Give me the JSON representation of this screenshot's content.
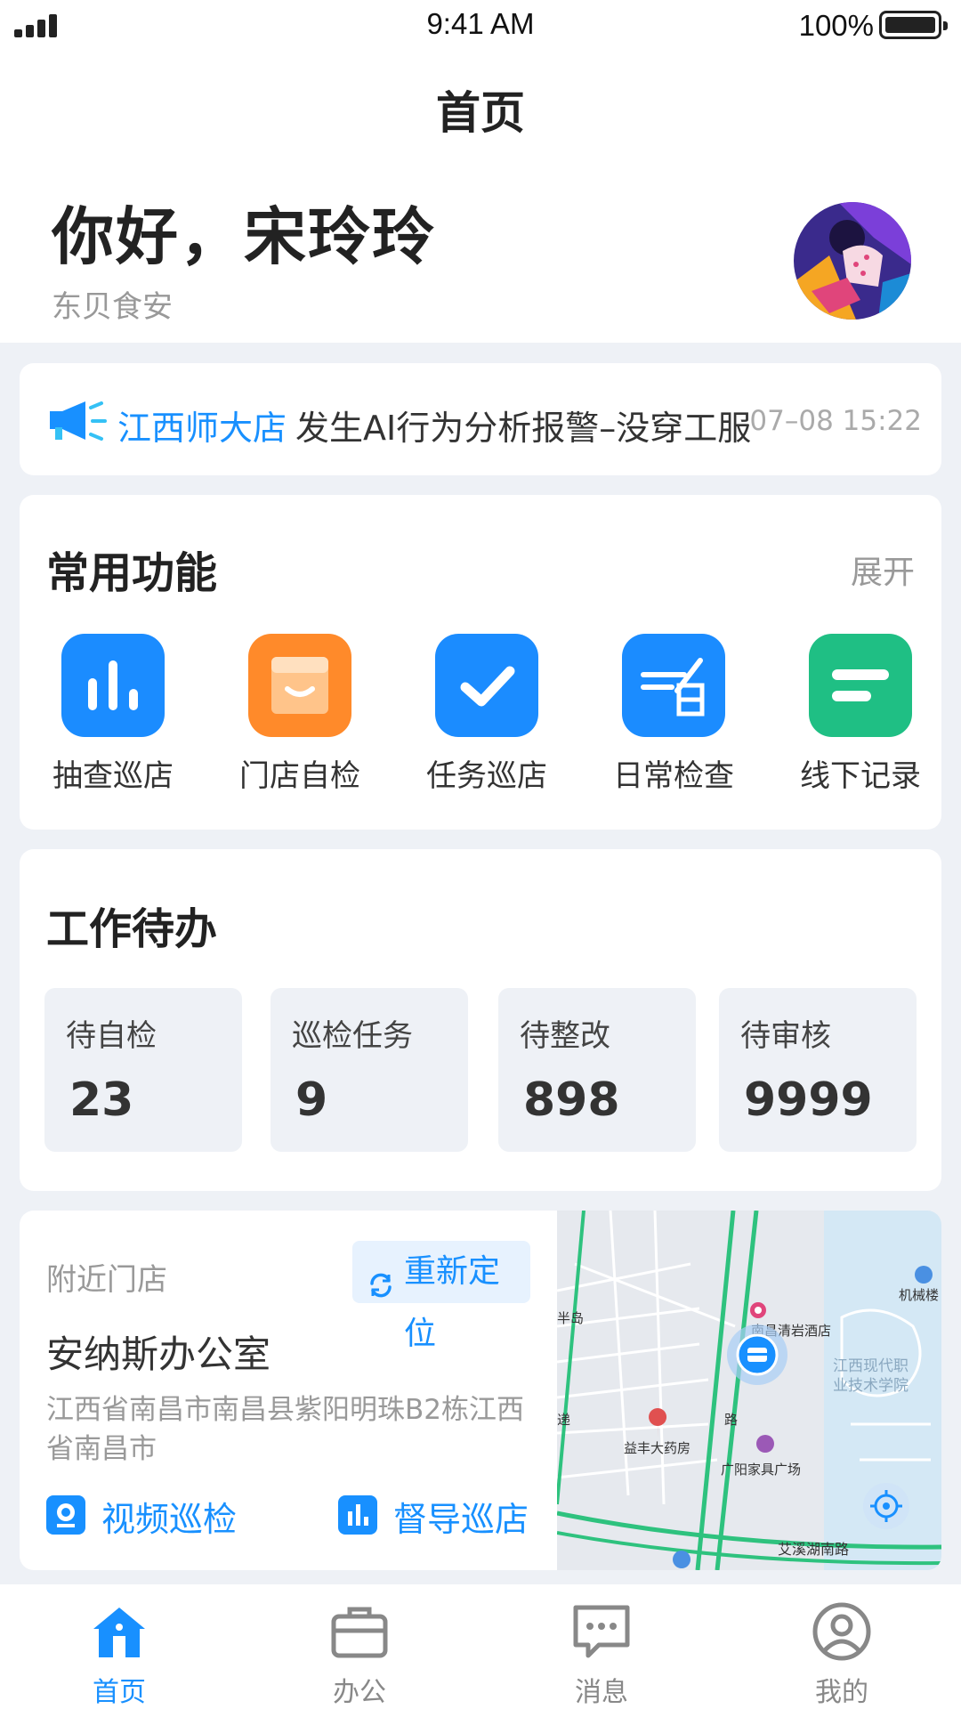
{
  "status_bar": {
    "time": "9:41 AM",
    "battery": "100%"
  },
  "header": {
    "title": "首页",
    "greeting": "你好，宋玲玲",
    "company": "东贝食安"
  },
  "notice": {
    "store": "江西师大店",
    "message": "发生AI行为分析报警–没穿工服",
    "time": "07–08 15:22"
  },
  "features": {
    "title": "常用功能",
    "expand_label": "展开",
    "items": [
      {
        "label": "抽查巡店",
        "icon": "bar-chart-icon",
        "color": "#1b8cff"
      },
      {
        "label": "门店自检",
        "icon": "storefront-icon",
        "color": "#ff8a2a"
      },
      {
        "label": "任务巡店",
        "icon": "checkmark-icon",
        "color": "#1b8cff"
      },
      {
        "label": "日常检查",
        "icon": "daily-calendar-icon",
        "color": "#1b8cff"
      },
      {
        "label": "线下记录",
        "icon": "record-lines-icon",
        "color": "#1fbf84"
      }
    ]
  },
  "todo": {
    "title": "工作待办",
    "items": [
      {
        "label": "待自检",
        "value": "23"
      },
      {
        "label": "巡检任务",
        "value": "9"
      },
      {
        "label": "待整改",
        "value": "898"
      },
      {
        "label": "待审核",
        "value": "9999"
      }
    ]
  },
  "nearby": {
    "title": "附近门店",
    "relocate_label": "重新定位",
    "shop_name": "安纳斯办公室",
    "address": "江西省南昌市南昌县紫阳明珠B2栋江西省南昌市",
    "video_label": "视频巡检",
    "supervise_label": "督导巡店",
    "map_labels": {
      "hotel": "南昌清岩酒店",
      "college": "江西现代职业技术学院",
      "building": "机械楼",
      "pharmacy": "益丰大药房",
      "furniture": "广阳家具广场",
      "road": "艾溪湖南路",
      "peninsula": "半岛",
      "edge": "递",
      "road_fragment": "路"
    }
  },
  "tabs": [
    {
      "label": "首页",
      "icon": "home-icon",
      "active": true
    },
    {
      "label": "办公",
      "icon": "briefcase-icon",
      "active": false
    },
    {
      "label": "消息",
      "icon": "message-icon",
      "active": false
    },
    {
      "label": "我的",
      "icon": "profile-icon",
      "active": false
    }
  ],
  "colors": {
    "accent": "#1890ff",
    "background": "#eef1f6"
  }
}
